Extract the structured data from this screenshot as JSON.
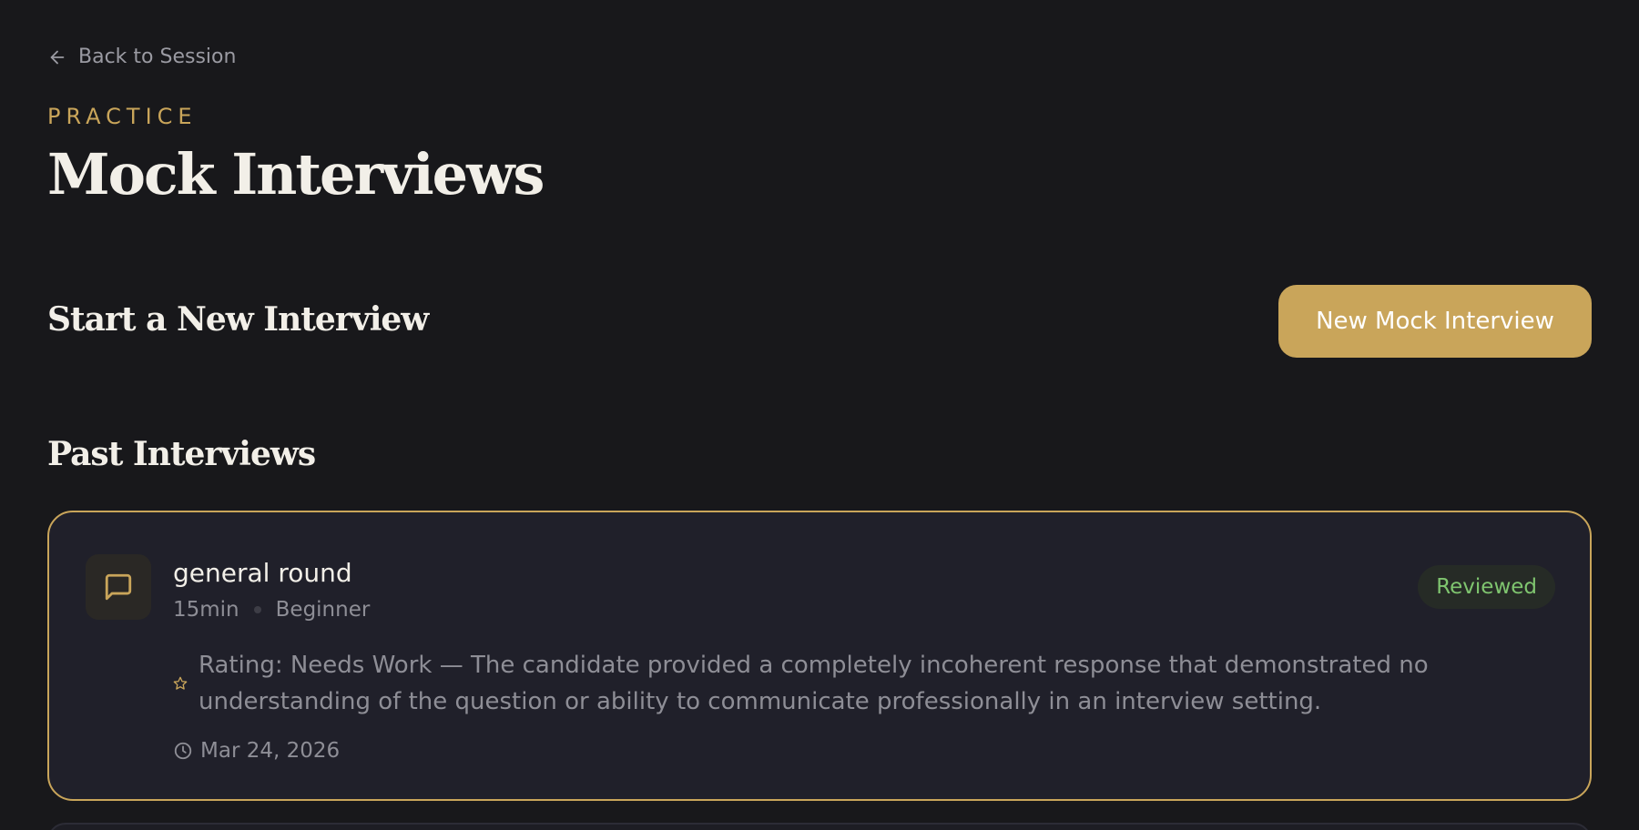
{
  "nav": {
    "back_label": "Back to Session",
    "back_icon": "arrow-left-icon"
  },
  "header": {
    "eyebrow": "PRACTICE",
    "title": "Mock Interviews"
  },
  "new_section": {
    "title": "Start a New Interview",
    "button_label": "New Mock Interview"
  },
  "past_section": {
    "title": "Past Interviews",
    "interviews": [
      {
        "title": "general round",
        "duration": "15min",
        "level": "Beginner",
        "status": "Reviewed",
        "rating_text": "Rating: Needs Work — The candidate provided a completely incoherent response that demonstrated no understanding of the question or ability to communicate professionally in an interview setting.",
        "date": "Mar 24, 2026",
        "icon": "chat-bubble-icon"
      }
    ]
  },
  "colors": {
    "background": "#18181b",
    "accent": "#c9a55a",
    "card_background": "#20202a",
    "status_green": "#7fc56f",
    "muted_text": "#8e8e96"
  }
}
